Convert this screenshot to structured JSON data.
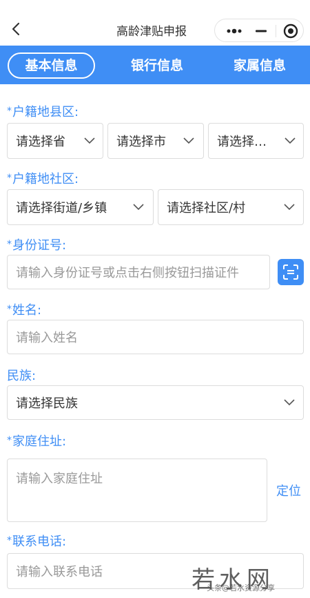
{
  "navbar": {
    "title": "高龄津贴申报"
  },
  "tabs": [
    {
      "label": "基本信息",
      "active": true
    },
    {
      "label": "银行信息",
      "active": false
    },
    {
      "label": "家属信息",
      "active": false
    }
  ],
  "form": {
    "hukou_county": {
      "label": "户籍地县区:",
      "required_mark": "*",
      "province_placeholder": "请选择省",
      "city_placeholder": "请选择市",
      "district_placeholder": "请选择…"
    },
    "hukou_community": {
      "label": "户籍地社区:",
      "required_mark": "*",
      "street_placeholder": "请选择街道/乡镇",
      "community_placeholder": "请选择社区/村"
    },
    "id_number": {
      "label": "身份证号:",
      "required_mark": "*",
      "placeholder": "请输入身份证号或点击右侧按钮扫描证件"
    },
    "name": {
      "label": "姓名:",
      "required_mark": "*",
      "placeholder": "请输入姓名"
    },
    "ethnicity": {
      "label": "民族:",
      "placeholder": "请选择民族"
    },
    "address": {
      "label": "家庭住址:",
      "required_mark": "*",
      "placeholder": "请输入家庭住址",
      "locate_label": "定位"
    },
    "phone": {
      "label": "联系电话:",
      "required_mark": "*",
      "placeholder": "请输入联系电话"
    }
  },
  "watermark": {
    "text": "若水网",
    "small_text": "头条@若水资源分享"
  },
  "colors": {
    "accent": "#3f8ef5",
    "border": "#dcdcdc",
    "placeholder": "#999999"
  }
}
